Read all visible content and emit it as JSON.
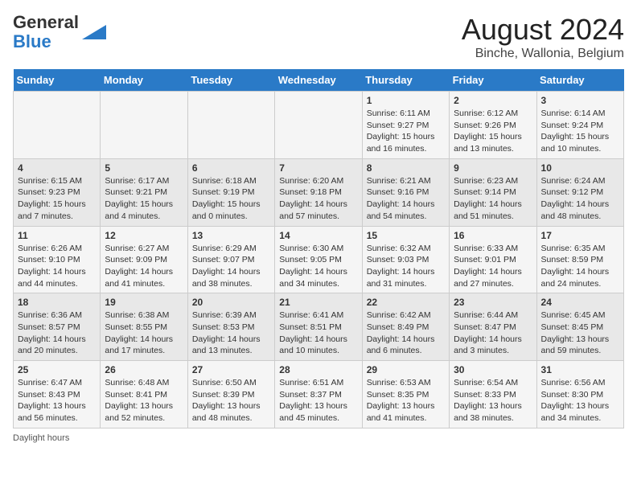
{
  "header": {
    "logo_general": "General",
    "logo_blue": "Blue",
    "month_title": "August 2024",
    "location": "Binche, Wallonia, Belgium"
  },
  "days_of_week": [
    "Sunday",
    "Monday",
    "Tuesday",
    "Wednesday",
    "Thursday",
    "Friday",
    "Saturday"
  ],
  "weeks": [
    [
      {
        "day": "",
        "info": ""
      },
      {
        "day": "",
        "info": ""
      },
      {
        "day": "",
        "info": ""
      },
      {
        "day": "",
        "info": ""
      },
      {
        "day": "1",
        "info": "Sunrise: 6:11 AM\nSunset: 9:27 PM\nDaylight: 15 hours and 16 minutes."
      },
      {
        "day": "2",
        "info": "Sunrise: 6:12 AM\nSunset: 9:26 PM\nDaylight: 15 hours and 13 minutes."
      },
      {
        "day": "3",
        "info": "Sunrise: 6:14 AM\nSunset: 9:24 PM\nDaylight: 15 hours and 10 minutes."
      }
    ],
    [
      {
        "day": "4",
        "info": "Sunrise: 6:15 AM\nSunset: 9:23 PM\nDaylight: 15 hours and 7 minutes."
      },
      {
        "day": "5",
        "info": "Sunrise: 6:17 AM\nSunset: 9:21 PM\nDaylight: 15 hours and 4 minutes."
      },
      {
        "day": "6",
        "info": "Sunrise: 6:18 AM\nSunset: 9:19 PM\nDaylight: 15 hours and 0 minutes."
      },
      {
        "day": "7",
        "info": "Sunrise: 6:20 AM\nSunset: 9:18 PM\nDaylight: 14 hours and 57 minutes."
      },
      {
        "day": "8",
        "info": "Sunrise: 6:21 AM\nSunset: 9:16 PM\nDaylight: 14 hours and 54 minutes."
      },
      {
        "day": "9",
        "info": "Sunrise: 6:23 AM\nSunset: 9:14 PM\nDaylight: 14 hours and 51 minutes."
      },
      {
        "day": "10",
        "info": "Sunrise: 6:24 AM\nSunset: 9:12 PM\nDaylight: 14 hours and 48 minutes."
      }
    ],
    [
      {
        "day": "11",
        "info": "Sunrise: 6:26 AM\nSunset: 9:10 PM\nDaylight: 14 hours and 44 minutes."
      },
      {
        "day": "12",
        "info": "Sunrise: 6:27 AM\nSunset: 9:09 PM\nDaylight: 14 hours and 41 minutes."
      },
      {
        "day": "13",
        "info": "Sunrise: 6:29 AM\nSunset: 9:07 PM\nDaylight: 14 hours and 38 minutes."
      },
      {
        "day": "14",
        "info": "Sunrise: 6:30 AM\nSunset: 9:05 PM\nDaylight: 14 hours and 34 minutes."
      },
      {
        "day": "15",
        "info": "Sunrise: 6:32 AM\nSunset: 9:03 PM\nDaylight: 14 hours and 31 minutes."
      },
      {
        "day": "16",
        "info": "Sunrise: 6:33 AM\nSunset: 9:01 PM\nDaylight: 14 hours and 27 minutes."
      },
      {
        "day": "17",
        "info": "Sunrise: 6:35 AM\nSunset: 8:59 PM\nDaylight: 14 hours and 24 minutes."
      }
    ],
    [
      {
        "day": "18",
        "info": "Sunrise: 6:36 AM\nSunset: 8:57 PM\nDaylight: 14 hours and 20 minutes."
      },
      {
        "day": "19",
        "info": "Sunrise: 6:38 AM\nSunset: 8:55 PM\nDaylight: 14 hours and 17 minutes."
      },
      {
        "day": "20",
        "info": "Sunrise: 6:39 AM\nSunset: 8:53 PM\nDaylight: 14 hours and 13 minutes."
      },
      {
        "day": "21",
        "info": "Sunrise: 6:41 AM\nSunset: 8:51 PM\nDaylight: 14 hours and 10 minutes."
      },
      {
        "day": "22",
        "info": "Sunrise: 6:42 AM\nSunset: 8:49 PM\nDaylight: 14 hours and 6 minutes."
      },
      {
        "day": "23",
        "info": "Sunrise: 6:44 AM\nSunset: 8:47 PM\nDaylight: 14 hours and 3 minutes."
      },
      {
        "day": "24",
        "info": "Sunrise: 6:45 AM\nSunset: 8:45 PM\nDaylight: 13 hours and 59 minutes."
      }
    ],
    [
      {
        "day": "25",
        "info": "Sunrise: 6:47 AM\nSunset: 8:43 PM\nDaylight: 13 hours and 56 minutes."
      },
      {
        "day": "26",
        "info": "Sunrise: 6:48 AM\nSunset: 8:41 PM\nDaylight: 13 hours and 52 minutes."
      },
      {
        "day": "27",
        "info": "Sunrise: 6:50 AM\nSunset: 8:39 PM\nDaylight: 13 hours and 48 minutes."
      },
      {
        "day": "28",
        "info": "Sunrise: 6:51 AM\nSunset: 8:37 PM\nDaylight: 13 hours and 45 minutes."
      },
      {
        "day": "29",
        "info": "Sunrise: 6:53 AM\nSunset: 8:35 PM\nDaylight: 13 hours and 41 minutes."
      },
      {
        "day": "30",
        "info": "Sunrise: 6:54 AM\nSunset: 8:33 PM\nDaylight: 13 hours and 38 minutes."
      },
      {
        "day": "31",
        "info": "Sunrise: 6:56 AM\nSunset: 8:30 PM\nDaylight: 13 hours and 34 minutes."
      }
    ]
  ],
  "footer": {
    "daylight_label": "Daylight hours"
  }
}
